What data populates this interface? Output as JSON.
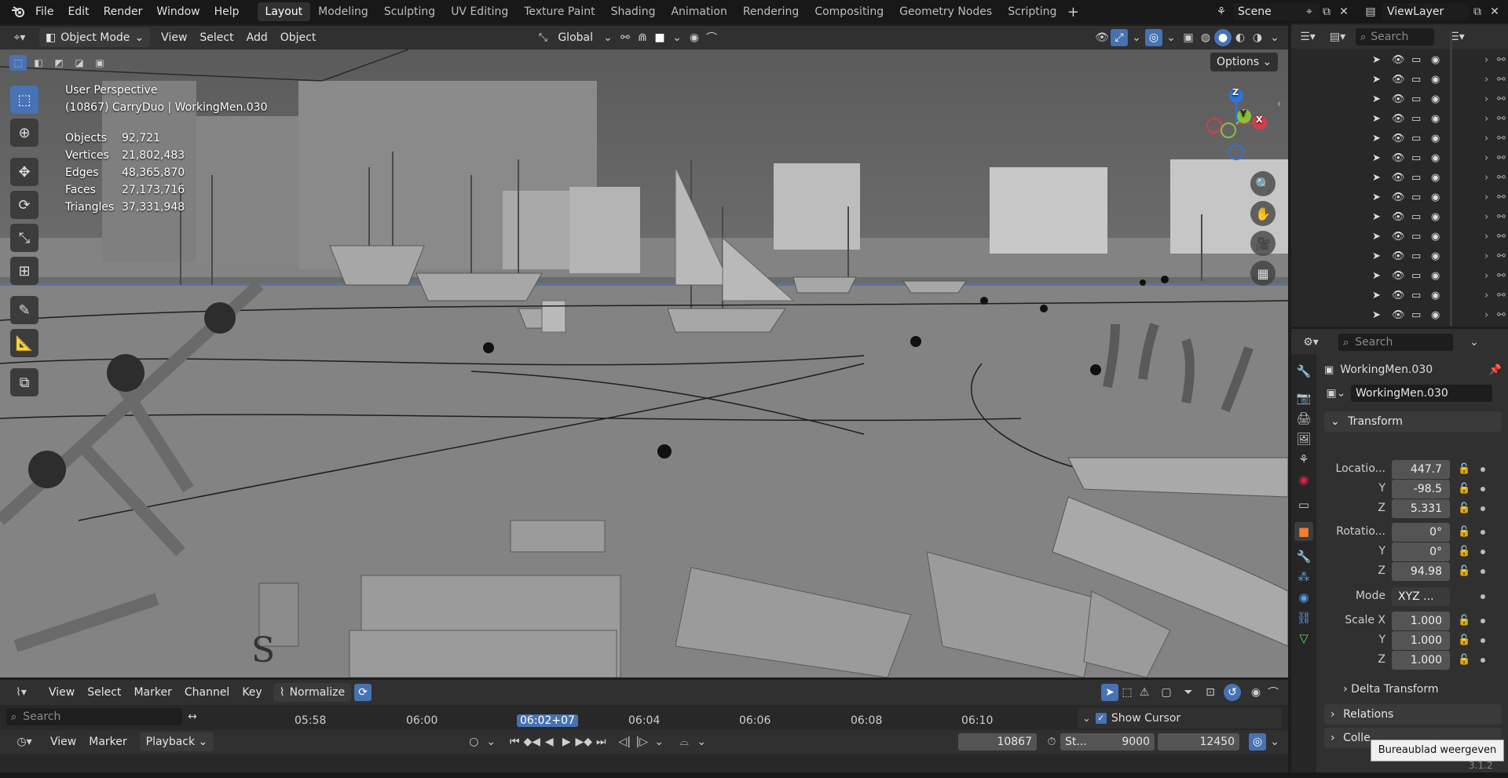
{
  "topbar": {
    "menu": [
      "File",
      "Edit",
      "Render",
      "Window",
      "Help"
    ],
    "workspaces": [
      "Layout",
      "Modeling",
      "Sculpting",
      "UV Editing",
      "Texture Paint",
      "Shading",
      "Animation",
      "Rendering",
      "Compositing",
      "Geometry Nodes",
      "Scripting"
    ],
    "active_workspace": "Layout",
    "scene": "Scene",
    "view_layer": "ViewLayer"
  },
  "viewport_header": {
    "mode": "Object Mode",
    "menus": [
      "View",
      "Select",
      "Add",
      "Object"
    ],
    "orientation": "Global",
    "options_label": "Options"
  },
  "viewport_overlay": {
    "view_name": "User Perspective",
    "active": "(10867) CarryDuo | WorkingMen.030",
    "stats": [
      {
        "label": "Objects",
        "value": "92,721"
      },
      {
        "label": "Vertices",
        "value": "21,802,483"
      },
      {
        "label": "Edges",
        "value": "48,365,870"
      },
      {
        "label": "Faces",
        "value": "27,173,716"
      },
      {
        "label": "Triangles",
        "value": "37,331,948"
      }
    ],
    "gizmo": {
      "z": "Z",
      "y": "Y",
      "x": "X"
    }
  },
  "timeline": {
    "menus": [
      "View",
      "Select",
      "Marker",
      "Channel",
      "Key"
    ],
    "normalize": "Normalize",
    "search_placeholder": "Search",
    "ticks": [
      "05:58",
      "06:00",
      "06:02+07",
      "06:04",
      "06:06",
      "06:08",
      "06:10"
    ],
    "current_time": "06:02+07",
    "show_cursor": "Show Cursor"
  },
  "playbar": {
    "menus": [
      "View",
      "Marker"
    ],
    "playback": "Playback",
    "current_frame": "10867",
    "start_label": "St...",
    "start_frame": "9000",
    "end_frame": "12450"
  },
  "outliner": {
    "search_placeholder": "Search",
    "row_count": 14
  },
  "properties": {
    "search_placeholder": "Search",
    "object_name": "WorkingMen.030",
    "object_field": "WorkingMen.030",
    "transform_title": "Transform",
    "location_label": "Locatio...",
    "location": {
      "x": "447.7",
      "y": "-98.5",
      "z": "5.331"
    },
    "rotation_label": "Rotatio...",
    "rotation": {
      "x": "0°",
      "y": "0°",
      "z": "94.98"
    },
    "mode_label": "Mode",
    "mode_value": "XYZ ...",
    "scale_label": "Scale X",
    "scale": {
      "x": "1.000",
      "y": "1.000",
      "z": "1.000"
    },
    "axis_y": "Y",
    "axis_z": "Z",
    "delta_transform": "Delta Transform",
    "relations": "Relations",
    "collections": "Colle"
  },
  "tooltip": "Bureaublad weergeven",
  "statusbar": {
    "version": "3.1.2"
  }
}
